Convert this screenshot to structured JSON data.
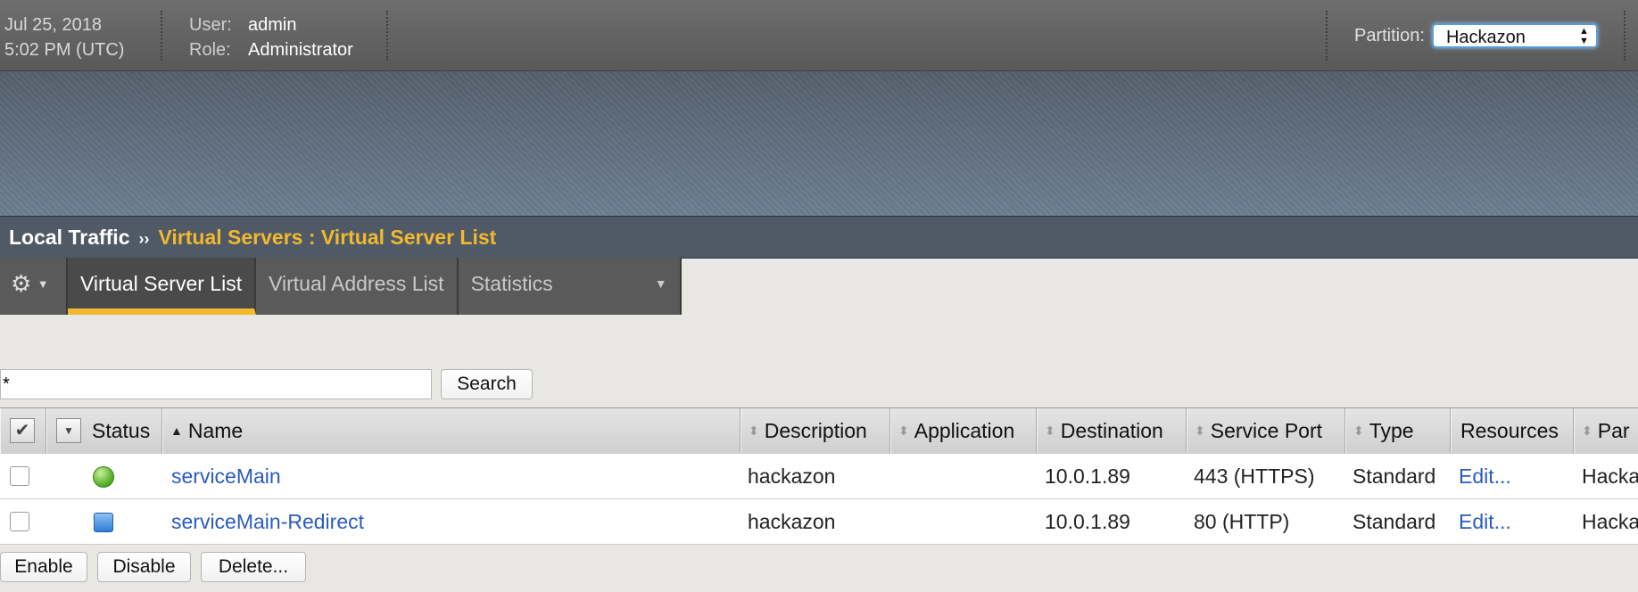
{
  "header": {
    "date": "Jul 25, 2018",
    "time": "5:02 PM (UTC)",
    "user_label": "User:",
    "user_value": "admin",
    "role_label": "Role:",
    "role_value": "Administrator",
    "partition_label": "Partition:",
    "partition_value": "Hackazon"
  },
  "breadcrumb": {
    "section": "Local Traffic",
    "separator": "››",
    "page": "Virtual Servers : Virtual Server List"
  },
  "tabs": [
    {
      "label": "Virtual Server List",
      "active": true
    },
    {
      "label": "Virtual Address List",
      "active": false
    },
    {
      "label": "Statistics",
      "active": false
    }
  ],
  "search": {
    "value": "*",
    "button_label": "Search"
  },
  "table": {
    "columns": [
      "Status",
      "Name",
      "Description",
      "Application",
      "Destination",
      "Service Port",
      "Type",
      "Resources",
      "Par"
    ],
    "rows": [
      {
        "status": "available-green",
        "name": "serviceMain",
        "description": "hackazon",
        "application": "",
        "destination": "10.0.1.89",
        "service_port": "443 (HTTPS)",
        "type": "Standard",
        "resources": "Edit...",
        "partition": "Hacka"
      },
      {
        "status": "unknown-blue",
        "name": "serviceMain-Redirect",
        "description": "hackazon",
        "application": "",
        "destination": "10.0.1.89",
        "service_port": "80 (HTTP)",
        "type": "Standard",
        "resources": "Edit...",
        "partition": "Hacka"
      }
    ]
  },
  "actions": {
    "enable": "Enable",
    "disable": "Disable",
    "delete": "Delete..."
  },
  "colors": {
    "accent": "#f2b82e",
    "link": "#2a5bbf"
  }
}
